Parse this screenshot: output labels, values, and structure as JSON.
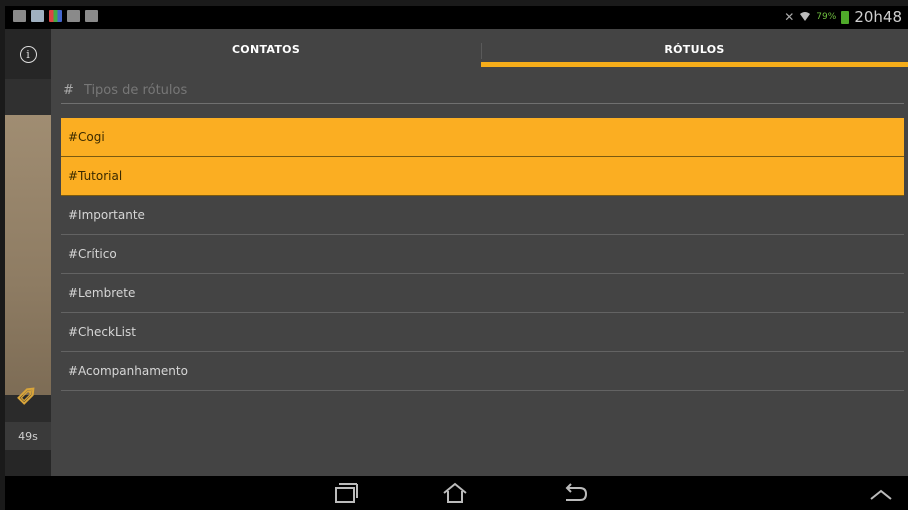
{
  "status_bar": {
    "icons": [
      "email-icon",
      "image-icon",
      "chart-icon",
      "calculator-icon",
      "gallery-icon"
    ],
    "battery": "79%",
    "time": "20h48"
  },
  "left_strip": {
    "info_label": "i",
    "timer": "49s"
  },
  "tabs": [
    {
      "label": "CONTATOS",
      "active": false
    },
    {
      "label": "RÓTULOS",
      "active": true
    }
  ],
  "search": {
    "prefix": "#",
    "placeholder": "Tipos de rótulos",
    "value": ""
  },
  "labels": [
    {
      "text": "#Cogi",
      "selected": true
    },
    {
      "text": "#Tutorial",
      "selected": true
    },
    {
      "text": "#Importante",
      "selected": false
    },
    {
      "text": "#Crítico",
      "selected": false
    },
    {
      "text": "#Lembrete",
      "selected": false
    },
    {
      "text": "#CheckList",
      "selected": false
    },
    {
      "text": "#Acompanhamento",
      "selected": false
    }
  ],
  "navbar": {
    "buttons": [
      "recent-apps-icon",
      "home-icon",
      "back-icon",
      "chevron-up-icon"
    ]
  },
  "colors": {
    "accent": "#f6ad1a",
    "panel": "#444444",
    "selected_row": "#fbae22"
  }
}
